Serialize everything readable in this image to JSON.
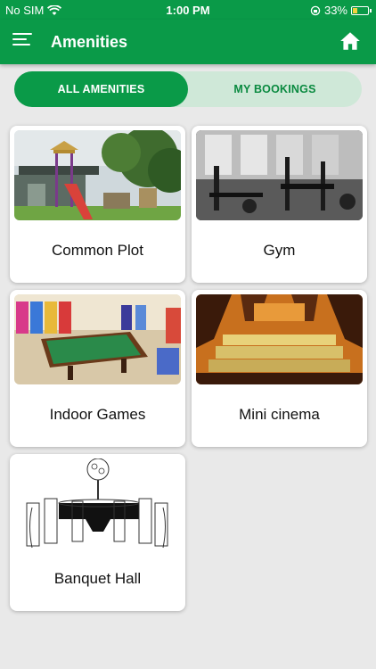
{
  "status_bar": {
    "carrier": "No SIM",
    "time": "1:00 PM",
    "battery": "33%",
    "battery_level": 0.33
  },
  "app_bar": {
    "title": "Amenities",
    "menu_icon": "menu-icon",
    "home_icon": "home-icon"
  },
  "tabs": [
    {
      "label": "ALL AMENITIES",
      "active": true
    },
    {
      "label": "MY BOOKINGS",
      "active": false
    }
  ],
  "amenities": [
    {
      "name": "Common Plot"
    },
    {
      "name": "Gym"
    },
    {
      "name": "Indoor Games"
    },
    {
      "name": "Mini cinema"
    },
    {
      "name": "Banquet Hall"
    }
  ],
  "colors": {
    "primary": "#0a9a48",
    "tab_track": "#cfe8d8",
    "background": "#e9e9e9"
  }
}
